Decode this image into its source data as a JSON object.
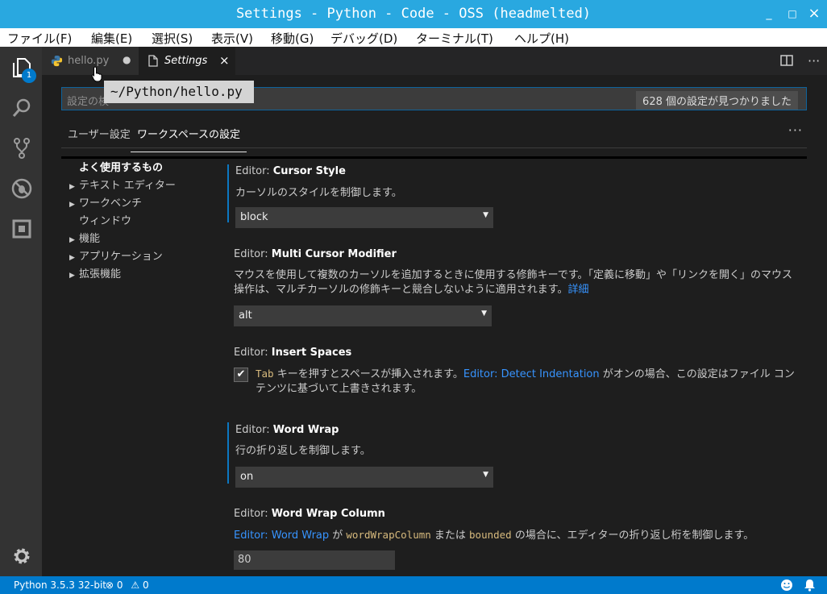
{
  "window": {
    "title": "Settings - Python - Code - OSS (headmelted)",
    "minimize": "_",
    "maximize": "□",
    "close": "×"
  },
  "menu": [
    "ファイル(F)",
    "編集(E)",
    "選択(S)",
    "表示(V)",
    "移動(G)",
    "デバッグ(D)",
    "ターミナル(T)",
    "ヘルプ(H)"
  ],
  "activity": {
    "explorer_badge": "1"
  },
  "tabs": [
    {
      "label": "hello.py",
      "dirty_marker": "●"
    },
    {
      "label": "Settings",
      "close": "×"
    }
  ],
  "tooltip": "~/Python/hello.py",
  "search": {
    "placeholder": "設定の検",
    "count": "628 個の設定が見つかりました"
  },
  "settings_tabs": {
    "user": "ユーザー設定",
    "workspace": "ワークスペースの設定",
    "more": "···"
  },
  "toc": [
    {
      "label": "よく使用するもの",
      "caret": ""
    },
    {
      "label": "テキスト エディター",
      "caret": "▶"
    },
    {
      "label": "ワークベンチ",
      "caret": "▶"
    },
    {
      "label": "ウィンドウ",
      "caret": ""
    },
    {
      "label": "機能",
      "caret": "▶"
    },
    {
      "label": "アプリケーション",
      "caret": "▶"
    },
    {
      "label": "拡張機能",
      "caret": "▶"
    }
  ],
  "settings": {
    "cursor_style": {
      "category": "Editor: ",
      "name": "Cursor Style",
      "description": "カーソルのスタイルを制御します。",
      "value": "block"
    },
    "multi_cursor": {
      "category": "Editor: ",
      "name": "Multi Cursor Modifier",
      "description": "マウスを使用して複数のカーソルを追加するときに使用する修飾キーです。「定義に移動」や「リンクを開く」のマウス操作は、マルチカーソルの修飾キーと競合しないように適用されます。",
      "link": "詳細",
      "value": "alt"
    },
    "insert_spaces": {
      "category": "Editor: ",
      "name": "Insert Spaces",
      "checked": "✔",
      "code": "Tab",
      "desc_a": " キーを押すとスペースが挿入されます。",
      "link": "Editor: Detect Indentation",
      "desc_b": " がオンの場合、この設定はファイル コンテンツに基づいて上書きされます。"
    },
    "word_wrap": {
      "category": "Editor: ",
      "name": "Word Wrap",
      "description": "行の折り返しを制御します。",
      "value": "on"
    },
    "word_wrap_column": {
      "category": "Editor: ",
      "name": "Word Wrap Column",
      "link": "Editor: Word Wrap",
      "desc_a": " が ",
      "code_a": "wordWrapColumn",
      "desc_b": " または ",
      "code_b": "bounded",
      "desc_c": " の場合に、エディターの折り返し桁を制御します。",
      "value": "80"
    }
  },
  "status": {
    "python": "Python 3.5.3 32-bit",
    "errors": "0",
    "warnings": "0"
  }
}
